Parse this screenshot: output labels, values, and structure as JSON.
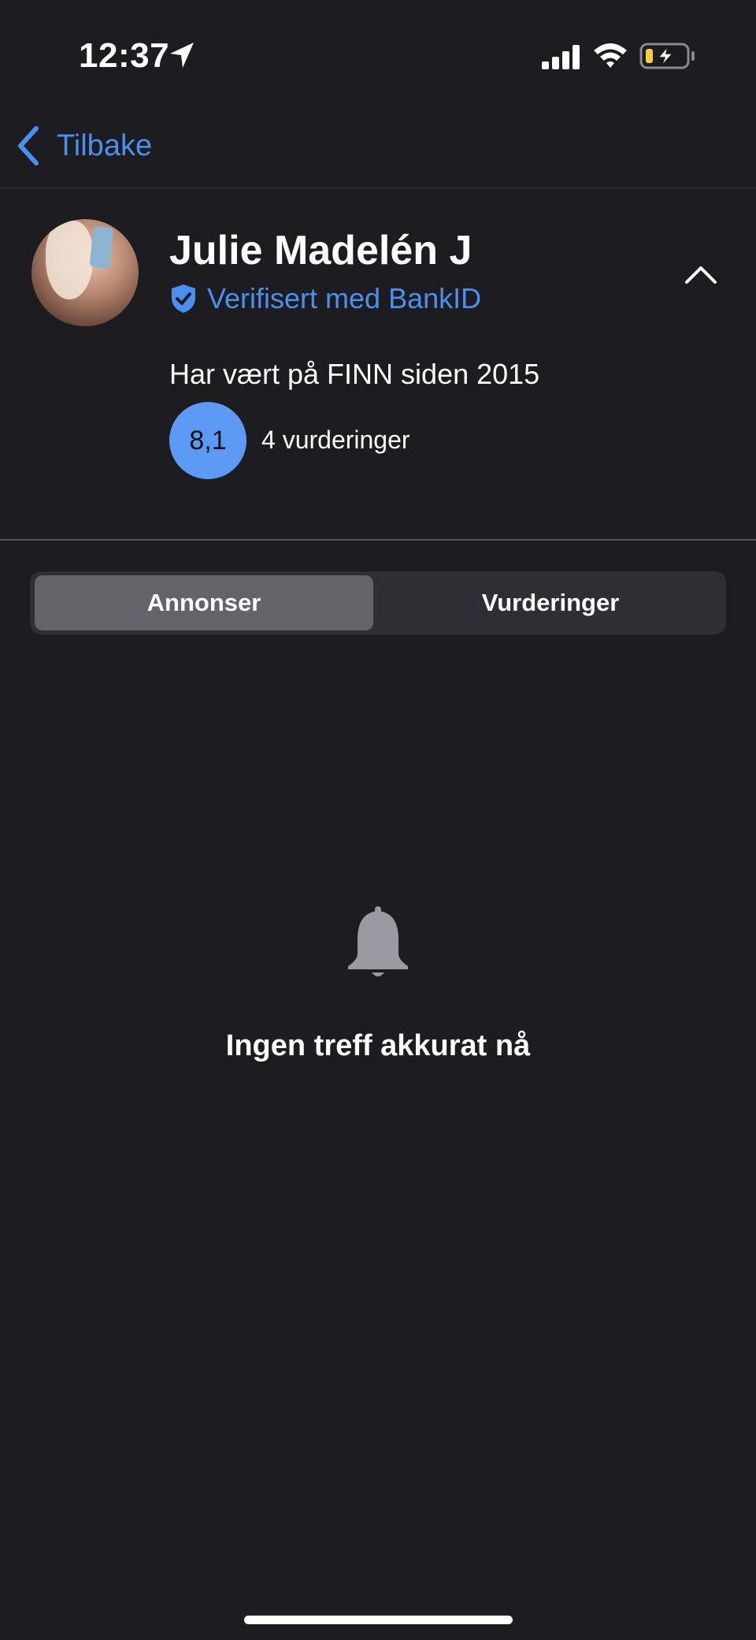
{
  "status_bar": {
    "time": "12:37"
  },
  "nav": {
    "back_label": "Tilbake"
  },
  "profile": {
    "name": "Julie Madelén J",
    "verified_label": "Verifisert med BankID",
    "member_since": "Har vært på FINN siden 2015",
    "rating": "8,1",
    "rating_count": "4 vurderinger"
  },
  "tabs": [
    {
      "label": "Annonser",
      "selected": true
    },
    {
      "label": "Vurderinger",
      "selected": false
    }
  ],
  "empty_state": {
    "icon": "bell-icon",
    "message": "Ingen treff akkurat nå"
  },
  "colors": {
    "background": "#1c1c21",
    "accent_blue": "#4b8ff0",
    "rating_badge": "#5c9af5",
    "segment_active": "#636369",
    "segment_track": "#2e2e35",
    "battery_charge": "#f4d03f"
  }
}
